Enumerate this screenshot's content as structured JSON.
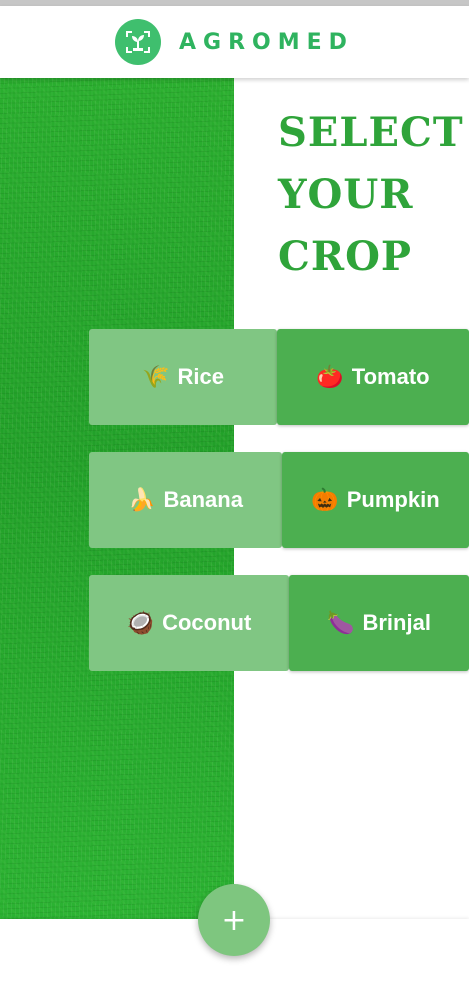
{
  "app": {
    "brand": "AGROMED",
    "logo_icon": "sprout-scan-icon",
    "accent_color": "#2fb35f"
  },
  "headline": {
    "line1": "SELECT",
    "line2": "YOUR",
    "line3": "CROP"
  },
  "crops": [
    {
      "label": "Rice",
      "emoji": "🌾",
      "icon": "rice-icon"
    },
    {
      "label": "Tomato",
      "emoji": "🍅",
      "icon": "tomato-icon"
    },
    {
      "label": "Banana",
      "emoji": "🍌",
      "icon": "banana-icon"
    },
    {
      "label": "Pumpkin",
      "emoji": "🎃",
      "icon": "pumpkin-icon"
    },
    {
      "label": "Coconut",
      "emoji": "🥥",
      "icon": "coconut-icon"
    },
    {
      "label": "Brinjal",
      "emoji": "🍆",
      "icon": "eggplant-icon"
    }
  ],
  "fab": {
    "label": "+",
    "icon": "plus-icon"
  }
}
